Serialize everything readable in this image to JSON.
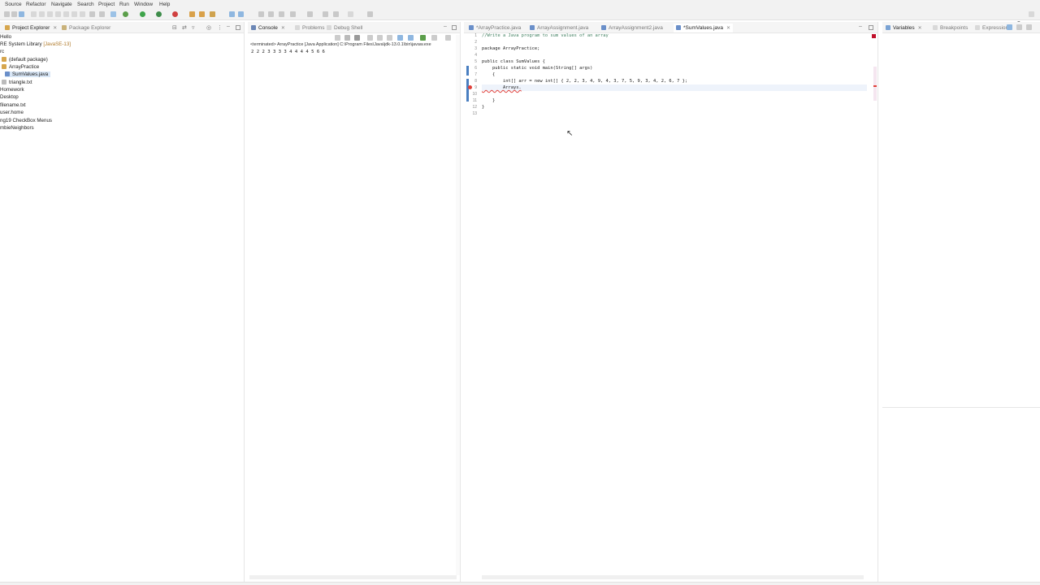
{
  "menu": [
    "Source",
    "Refactor",
    "Navigate",
    "Search",
    "Project",
    "Run",
    "Window",
    "Help"
  ],
  "left_pane": {
    "tabs": [
      {
        "label": "Project Explorer",
        "active": true
      },
      {
        "label": "Package Explorer",
        "active": false
      }
    ],
    "tree": [
      {
        "label": "Hello",
        "decor": ""
      },
      {
        "label": "RE System Library",
        "decor": "[JavaSE-13]"
      },
      {
        "label": "rc",
        "decor": ""
      },
      {
        "label": "(default package)",
        "decor": ""
      },
      {
        "label": "ArrayPractice",
        "decor": ""
      },
      {
        "label": "SumValues.java",
        "decor": ""
      },
      {
        "label": "triangle.txt",
        "decor": ""
      },
      {
        "label": "Homework",
        "decor": ""
      },
      {
        "label": "Desktop",
        "decor": ""
      },
      {
        "label": "filename.txt",
        "decor": ""
      },
      {
        "label": "user.home",
        "decor": ""
      },
      {
        "label": "ng19 CheckBox Menus",
        "decor": ""
      },
      {
        "label": "mbieNeighbors",
        "decor": ""
      }
    ]
  },
  "console_pane": {
    "tabs": [
      {
        "label": "Console",
        "active": true
      },
      {
        "label": "Problems",
        "active": false
      },
      {
        "label": "Debug Shell",
        "active": false
      }
    ],
    "status": "<terminated> ArrayPractice [Java Application] C:\\Program Files\\Java\\jdk-13.0.1\\bin\\javaw.exe",
    "output": "2 2 2 3 3 3 3 4 4 4 4 5 6 6"
  },
  "editor": {
    "tabs": [
      {
        "label": "*ArrayPractice.java",
        "active": false
      },
      {
        "label": "ArrayAssignment.java",
        "active": false
      },
      {
        "label": "ArrayAssignment2.java",
        "active": false
      },
      {
        "label": "*SumValues.java",
        "active": true
      }
    ],
    "line_numbers": [
      "1",
      "2",
      "3",
      "4",
      "5",
      "6",
      "7",
      "8",
      "9",
      "10",
      "11",
      "12",
      "13"
    ],
    "code": [
      "//Write a Java program to sum values of an array",
      "",
      "package ArrayPractice;",
      "",
      "public class SumValues {",
      "    public static void main(String[] args)",
      "    {",
      "        int[] arr = new int[] { 2, 2, 3, 4, 9, 4, 3, 7, 5, 9, 3, 4, 2, 6, 7 };",
      "        Arrays.",
      "",
      "    }",
      "}",
      ""
    ]
  },
  "right_pane": {
    "tabs": [
      {
        "label": "Variables",
        "active": true
      },
      {
        "label": "Breakpoints",
        "active": false
      },
      {
        "label": "Expressions",
        "active": false
      }
    ]
  },
  "colors": {
    "keyword": "#7f0055",
    "comment": "#3f7f5f",
    "selection": "#d8e6f6",
    "error_marker": "#e0403a",
    "toolbar_bg": "#f2f2f2"
  },
  "icons": [
    "search-icon",
    "run-icon",
    "debug-icon",
    "java-file-icon",
    "console-icon",
    "package-icon",
    "folder-icon",
    "close-icon",
    "minimize-icon",
    "maximize-icon"
  ]
}
